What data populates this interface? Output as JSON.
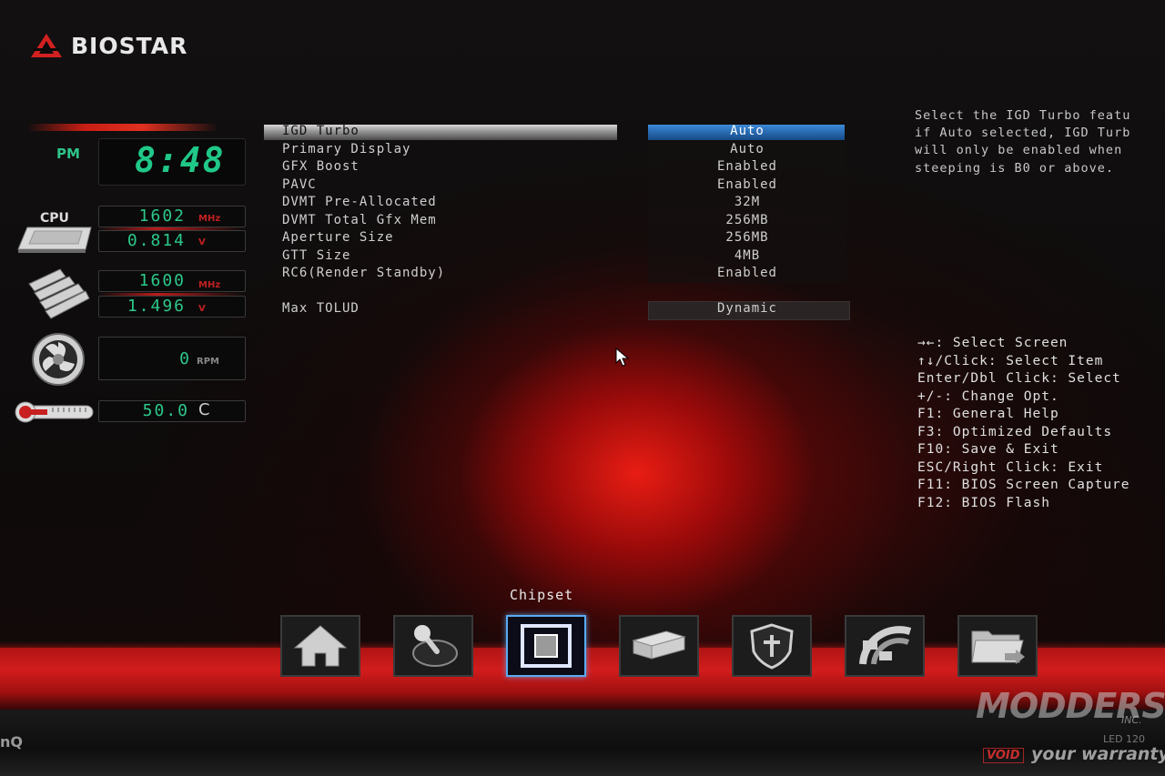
{
  "brand": {
    "name": "BIOSTAR"
  },
  "monitor": {
    "clock": {
      "ampm": "PM",
      "time": "8:48"
    },
    "cpu": {
      "label": "CPU",
      "freq": "1602",
      "freq_unit": "MHz",
      "volt": "0.814",
      "volt_unit": "V"
    },
    "memory": {
      "freq": "1600",
      "freq_unit": "MHz",
      "volt": "1.496",
      "volt_unit": "V"
    },
    "fan": {
      "speed": "0",
      "unit": "RPM"
    },
    "temp": {
      "value": "50.0",
      "unit": "C"
    }
  },
  "settings": [
    {
      "label": "IGD Turbo",
      "value": "Auto",
      "selected": true
    },
    {
      "label": "Primary Display",
      "value": "Auto"
    },
    {
      "label": "GFX Boost",
      "value": "Enabled"
    },
    {
      "label": "PAVC",
      "value": "Enabled"
    },
    {
      "label": "DVMT Pre-Allocated",
      "value": "32M"
    },
    {
      "label": "DVMT Total Gfx Mem",
      "value": "256MB"
    },
    {
      "label": "Aperture Size",
      "value": "256MB"
    },
    {
      "label": "GTT Size",
      "value": "4MB"
    },
    {
      "label": "RC6(Render Standby)",
      "value": "Enabled"
    },
    {
      "label": "Max TOLUD",
      "value": "Dynamic"
    }
  ],
  "help": {
    "description": [
      "Select the IGD Turbo featu",
      "if Auto selected, IGD Turb",
      "will only be enabled when",
      "steeping is B0 or above."
    ],
    "keys": [
      "→←: Select Screen",
      "↑↓/Click: Select Item",
      "Enter/Dbl Click: Select",
      "+/-: Change Opt.",
      "F1: General Help",
      "F3: Optimized Defaults",
      "F10: Save & Exit",
      "ESC/Right Click: Exit",
      "F11: BIOS Screen Capture",
      "F12: BIOS Flash"
    ]
  },
  "nav": {
    "active_label": "Chipset",
    "items": [
      {
        "name": "home-icon"
      },
      {
        "name": "joystick-icon"
      },
      {
        "name": "chip-icon"
      },
      {
        "name": "storage-icon"
      },
      {
        "name": "shield-icon"
      },
      {
        "name": "gauge-icon"
      },
      {
        "name": "folder-exit-icon"
      }
    ]
  },
  "bezel": {
    "brand": "nQ",
    "led": "LED 120"
  },
  "watermark": {
    "title": "MODDERS",
    "inc": "INC.",
    "void": "VOID",
    "tagline": "your warranty"
  },
  "colors": {
    "accent_green": "#2ec48a",
    "accent_red": "#c81e14",
    "selection_blue": "#2463a8",
    "nav_active": "#5aaaf0"
  }
}
